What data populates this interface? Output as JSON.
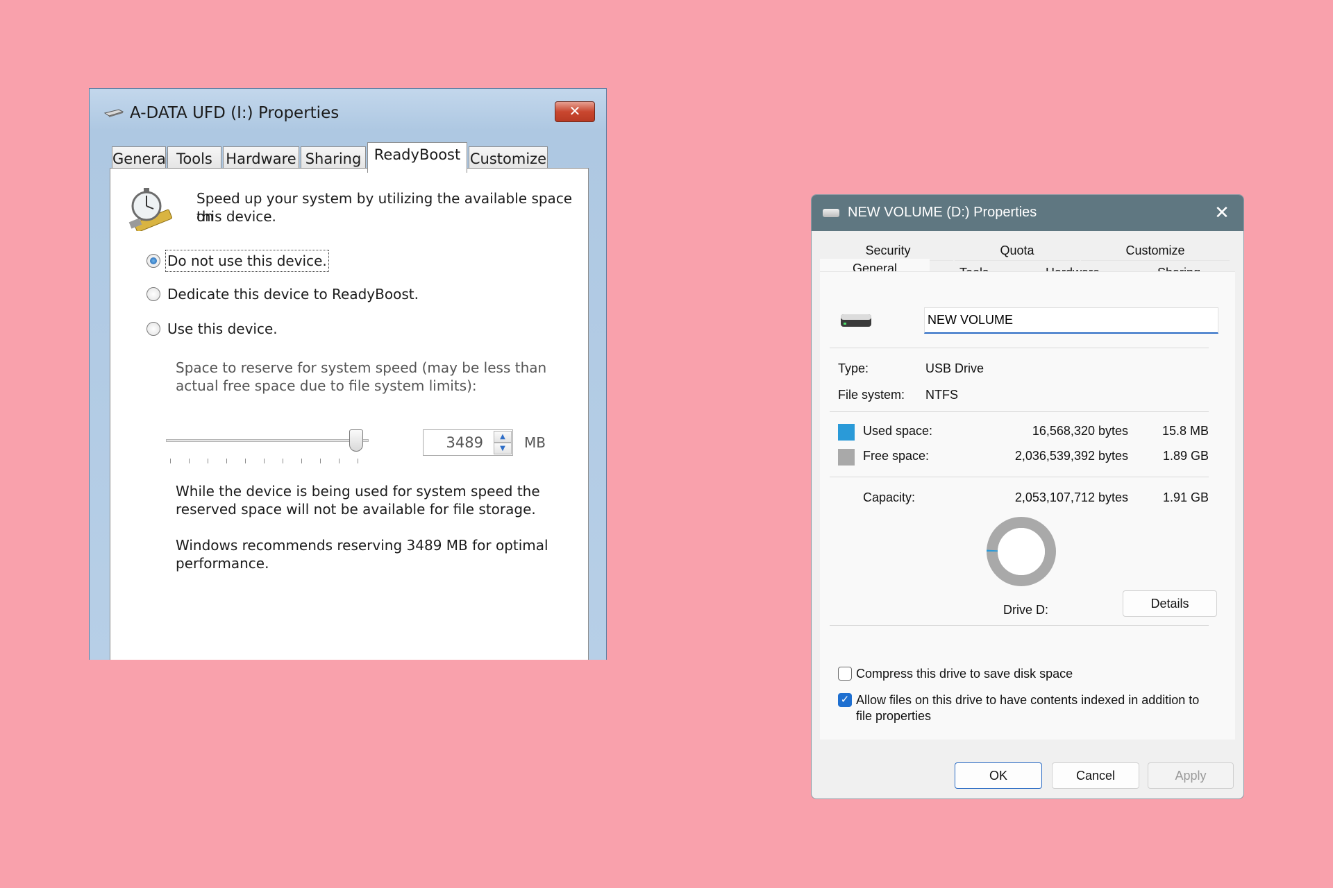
{
  "background_color": "#f9a1ac",
  "readyboost_dialog": {
    "title": "A-DATA UFD (I:) Properties",
    "close_glyph": "✕",
    "tabs": [
      "General",
      "Tools",
      "Hardware",
      "Sharing",
      "ReadyBoost",
      "Customize"
    ],
    "active_tab": "ReadyBoost",
    "intro_line1": "Speed up your system by utilizing the available space on",
    "intro_line2": "this device.",
    "options": [
      {
        "label": "Do not use this device.",
        "checked": true
      },
      {
        "label": "Dedicate this device to ReadyBoost.",
        "checked": false
      },
      {
        "label": "Use this device.",
        "checked": false
      }
    ],
    "reserve_line1": "Space to reserve for system speed (may be less than",
    "reserve_line2": "actual free space due to file system limits):",
    "slider_level": 1.0,
    "reserve_value": "3489",
    "unit": "MB",
    "note1_line1": "While the device is being used for system speed the",
    "note1_line2": "reserved space will not be available for file storage.",
    "note2_line1": "Windows recommends reserving 3489 MB for optimal",
    "note2_line2": "performance."
  },
  "volume_dialog": {
    "title": "NEW VOLUME (D:) Properties",
    "close_glyph": "✕",
    "tabs_row1": [
      "Security",
      "Quota",
      "Customize"
    ],
    "tabs_row2": [
      "General",
      "Tools",
      "Hardware",
      "Sharing"
    ],
    "active_tab": "General",
    "volume_name": "NEW VOLUME",
    "type_label": "Type:",
    "type_value": "USB Drive",
    "fs_label": "File system:",
    "fs_value": "NTFS",
    "used_label": "Used space:",
    "used_bytes": "16,568,320 bytes",
    "used_size": "15.8 MB",
    "free_label": "Free space:",
    "free_bytes": "2,036,539,392 bytes",
    "free_size": "1.89 GB",
    "capacity_label": "Capacity:",
    "capacity_bytes": "2,053,107,712 bytes",
    "capacity_size": "1.91 GB",
    "used_fraction": 0.008,
    "used_color": "#2a9ad8",
    "free_color": "#a9a9a9",
    "drive_label": "Drive D:",
    "details_label": "Details",
    "compress_label": "Compress this drive to save disk space",
    "compress_checked": false,
    "index_label_line1": "Allow files on this drive to have contents indexed in addition to",
    "index_label_line2": "file properties",
    "index_checked": true,
    "ok_label": "OK",
    "cancel_label": "Cancel",
    "apply_label": "Apply"
  }
}
